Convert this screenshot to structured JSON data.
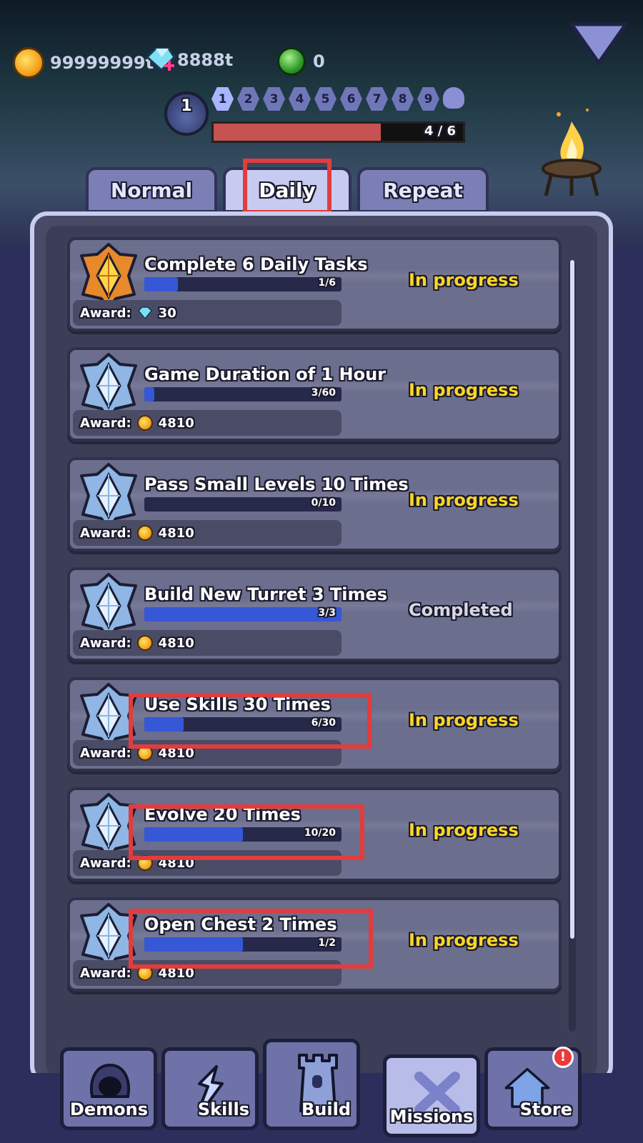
{
  "currencies": {
    "gold": "99999999t",
    "gems": "8888t",
    "orbs": "0"
  },
  "level": {
    "number": "1",
    "stages": [
      "1",
      "2",
      "3",
      "4",
      "5",
      "6",
      "7",
      "8",
      "9"
    ],
    "progress_text": "4 / 6",
    "progress_fraction": 0.667
  },
  "tabs": [
    {
      "label": "Normal"
    },
    {
      "label": "Daily"
    },
    {
      "label": "Repeat"
    }
  ],
  "award_label": "Award:",
  "missions": [
    {
      "title": "Complete 6 Daily Tasks",
      "progress": "1/6",
      "fraction": 0.167,
      "award_icon": "gem-icon",
      "award_value": "30",
      "status": "In progress"
    },
    {
      "title": "Game Duration of 1 Hour",
      "progress": "3/60",
      "fraction": 0.05,
      "award_icon": "coin-icon",
      "award_value": "4810",
      "status": "In progress"
    },
    {
      "title": "Pass Small Levels 10 Times",
      "progress": "0/10",
      "fraction": 0.0,
      "award_icon": "coin-icon",
      "award_value": "4810",
      "status": "In progress"
    },
    {
      "title": "Build New Turret 3 Times",
      "progress": "3/3",
      "fraction": 1.0,
      "award_icon": "coin-icon",
      "award_value": "4810",
      "status": "Completed"
    },
    {
      "title": "Use Skills 30 Times",
      "progress": "6/30",
      "fraction": 0.2,
      "award_icon": "coin-icon",
      "award_value": "4810",
      "status": "In progress"
    },
    {
      "title": "Evolve 20 Times",
      "progress": "10/20",
      "fraction": 0.5,
      "award_icon": "coin-icon",
      "award_value": "4810",
      "status": "In progress"
    },
    {
      "title": "Open Chest 2 Times",
      "progress": "1/2",
      "fraction": 0.5,
      "award_icon": "coin-icon",
      "award_value": "4810",
      "status": "In progress"
    }
  ],
  "nav": [
    {
      "label": "Demons",
      "icon": "demon-hood-icon"
    },
    {
      "label": "Skills",
      "icon": "skill-splash-icon"
    },
    {
      "label": "Build",
      "icon": "castle-tower-icon"
    },
    {
      "label": "Missions",
      "icon": "crossed-swords-icon"
    },
    {
      "label": "Store",
      "icon": "house-icon",
      "badge": "!"
    }
  ],
  "colors": {
    "highlight": "#e23c3c",
    "status_in_progress": "#ffd625",
    "progress_fill": "#3657d6"
  }
}
